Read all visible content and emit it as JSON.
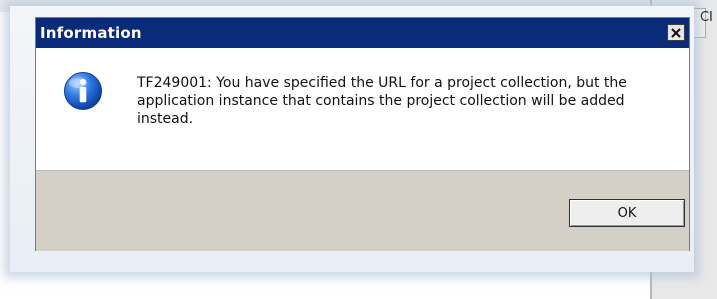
{
  "dialog": {
    "title": "Information",
    "message": "TF249001: You have specified the URL for a project collection, but the application instance that contains the project collection will be added instead.",
    "ok_label": "OK"
  },
  "background": {
    "right_label": "Cl"
  },
  "icons": {
    "info": "info-icon",
    "close": "close-icon"
  },
  "colors": {
    "title_bar": "#0a2a7a",
    "footer": "#d4d0c8",
    "info_icon": "#1a63d6"
  }
}
